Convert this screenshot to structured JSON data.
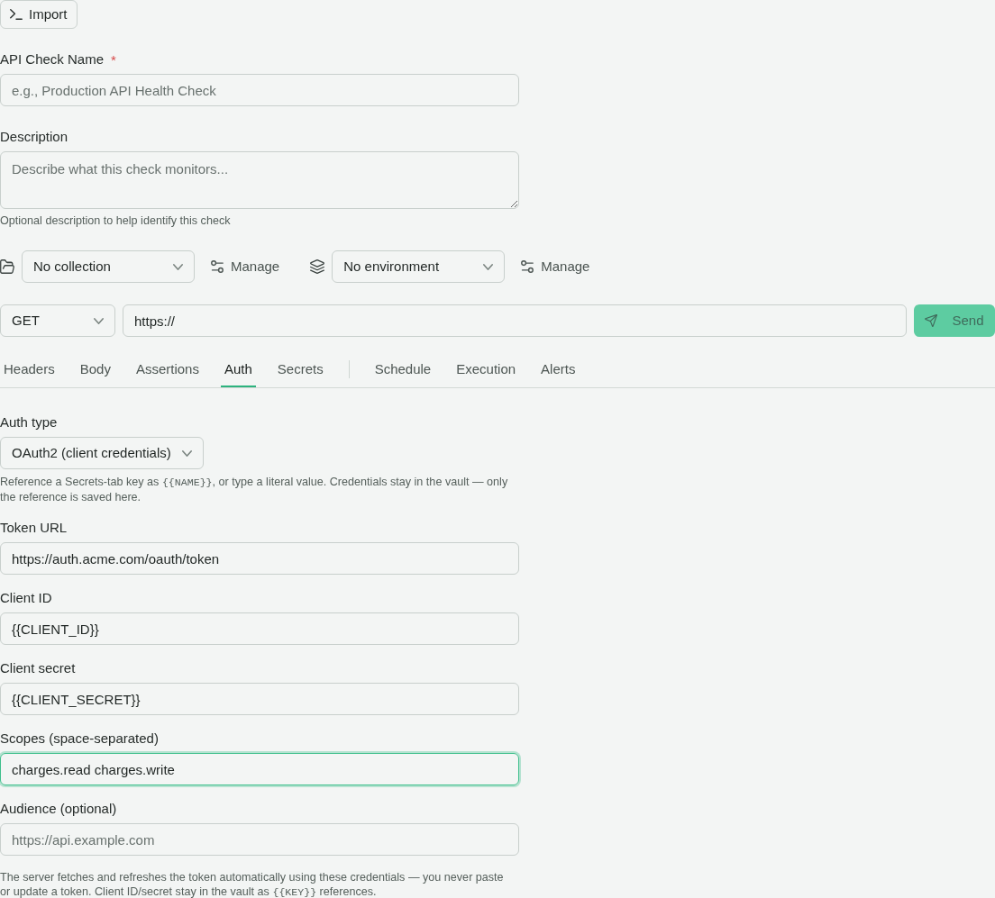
{
  "import_button": {
    "label": "Import"
  },
  "name_field": {
    "label": "API Check Name",
    "required_mark": "*",
    "placeholder": "e.g., Production API Health Check"
  },
  "description_field": {
    "label": "Description",
    "placeholder": "Describe what this check monitors...",
    "help": "Optional description to help identify this check"
  },
  "selectors": [
    {
      "kind": "collection",
      "value": "No collection",
      "manage_label": "Manage"
    },
    {
      "kind": "environment",
      "value": "No environment",
      "manage_label": "Manage"
    }
  ],
  "request": {
    "method": "GET",
    "url": "https://",
    "send": {
      "label": "Send",
      "disabled": true
    }
  },
  "tab_groups": [
    {
      "tabs": [
        {
          "label": "Headers",
          "selected": false
        },
        {
          "label": "Body",
          "selected": false
        },
        {
          "label": "Assertions",
          "selected": false
        },
        {
          "label": "Auth",
          "selected": true
        },
        {
          "label": "Secrets",
          "selected": false
        }
      ]
    },
    {
      "tabs": [
        {
          "label": "Schedule",
          "selected": false
        },
        {
          "label": "Execution",
          "selected": false
        },
        {
          "label": "Alerts",
          "selected": false
        }
      ]
    }
  ],
  "auth": {
    "type_label": "Auth type",
    "type_value": "OAuth2 (client credentials)",
    "help": [
      {
        "kind": "text",
        "text": "Reference a Secrets-tab key as "
      },
      {
        "kind": "code",
        "text": "{{NAME}}"
      },
      {
        "kind": "text",
        "text": ", or type a literal value. Credentials stay in the vault — only the reference is saved here."
      }
    ],
    "fields": [
      {
        "label": "Token URL",
        "value": "https://auth.acme.com/oauth/token",
        "focused": false
      },
      {
        "label": "Client ID",
        "value": "{{CLIENT_ID}}",
        "focused": false
      },
      {
        "label": "Client secret",
        "value": "{{CLIENT_SECRET}}",
        "focused": false
      },
      {
        "label": "Scopes (space-separated)",
        "value": "charges.read charges.write",
        "focused": true
      },
      {
        "label": "Audience (optional)",
        "placeholder": "https://api.example.com",
        "focused": false
      }
    ],
    "note": [
      {
        "kind": "text",
        "text": "The server fetches and refreshes the token automatically using these credentials — you never paste or update a token. Client ID/secret stay in the vault as "
      },
      {
        "kind": "code",
        "text": "{{KEY}}"
      },
      {
        "kind": "text",
        "text": " references."
      }
    ]
  }
}
